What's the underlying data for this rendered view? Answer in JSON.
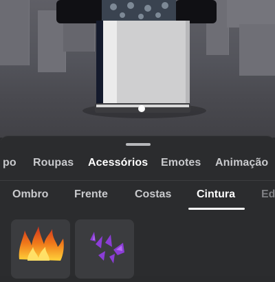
{
  "tabs": [
    "po",
    "Roupas",
    "Acessórios",
    "Emotes",
    "Animação"
  ],
  "subtabs": [
    "Ombro",
    "Frente",
    "Costas",
    "Cintura",
    "Ed"
  ],
  "active_tab": "Acessórios",
  "active_subtab": "Cintura",
  "items": [
    {
      "icon": "flame-accessory-icon"
    },
    {
      "icon": "purple-crystal-accessory-icon"
    }
  ],
  "colors": {
    "sheet_bg": "#2b2c2e",
    "tile_bg": "#3b3c3f",
    "text": "#c9cacd",
    "active_text": "#ffffff"
  }
}
